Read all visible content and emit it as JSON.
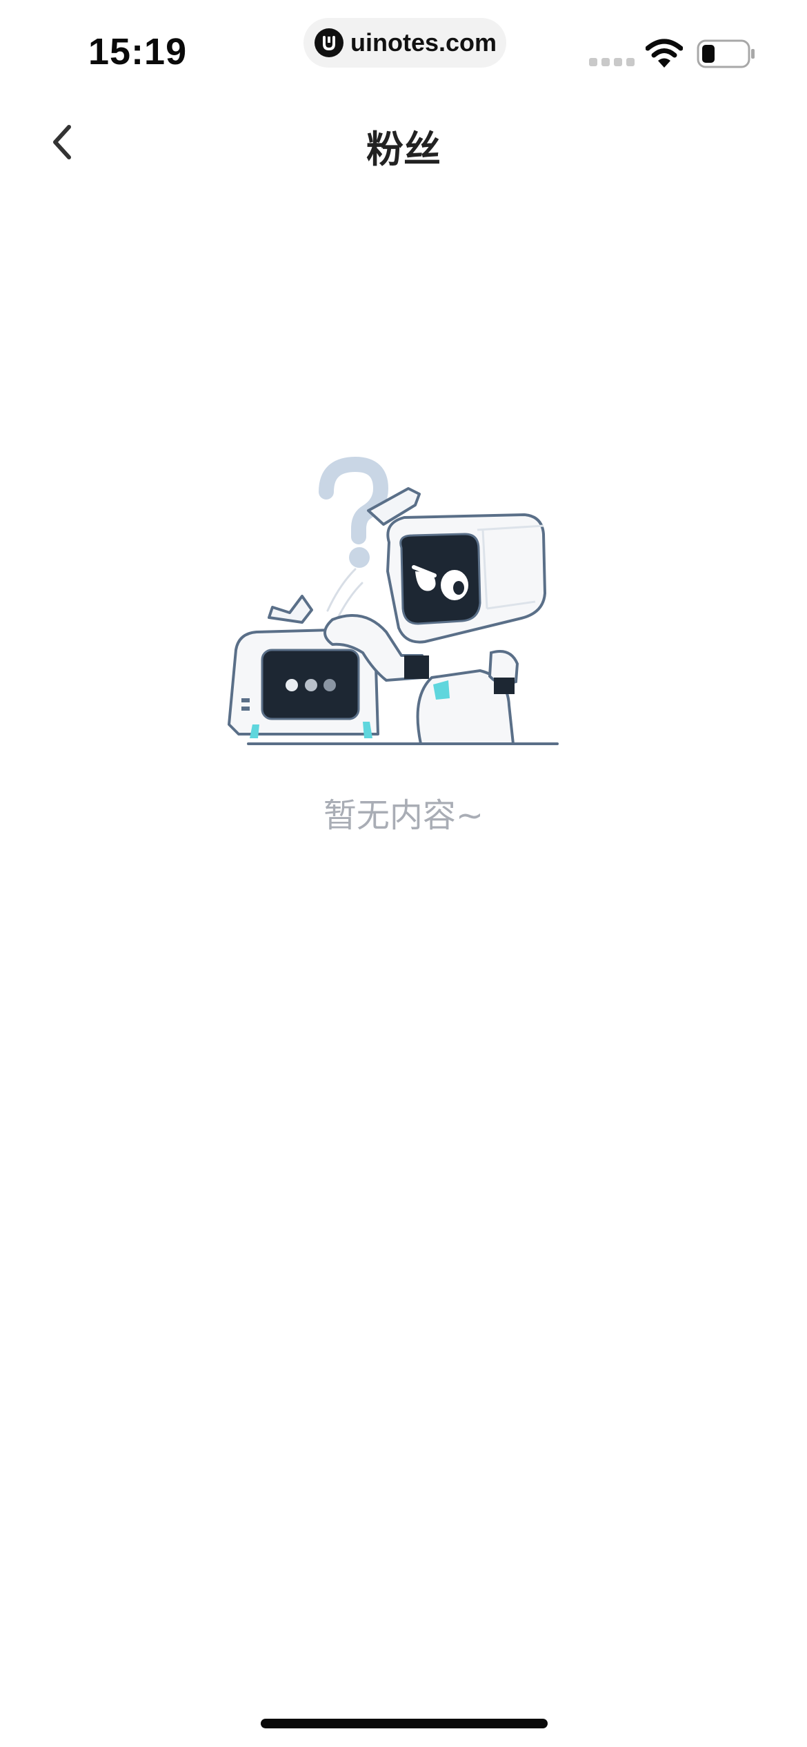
{
  "status_bar": {
    "time": "15:19",
    "url": "uinotes.com",
    "icons": [
      "signal-icon",
      "wifi-icon",
      "battery-icon"
    ]
  },
  "nav": {
    "back_icon": "chevron-left-icon",
    "title": "粉丝"
  },
  "empty_state": {
    "illustration": "robots-question-illustration",
    "text": "暂无内容~"
  },
  "colors": {
    "background": "#ffffff",
    "title": "#222222",
    "empty_text": "#a9adb5",
    "accent_cyan": "#5fd6dd"
  }
}
